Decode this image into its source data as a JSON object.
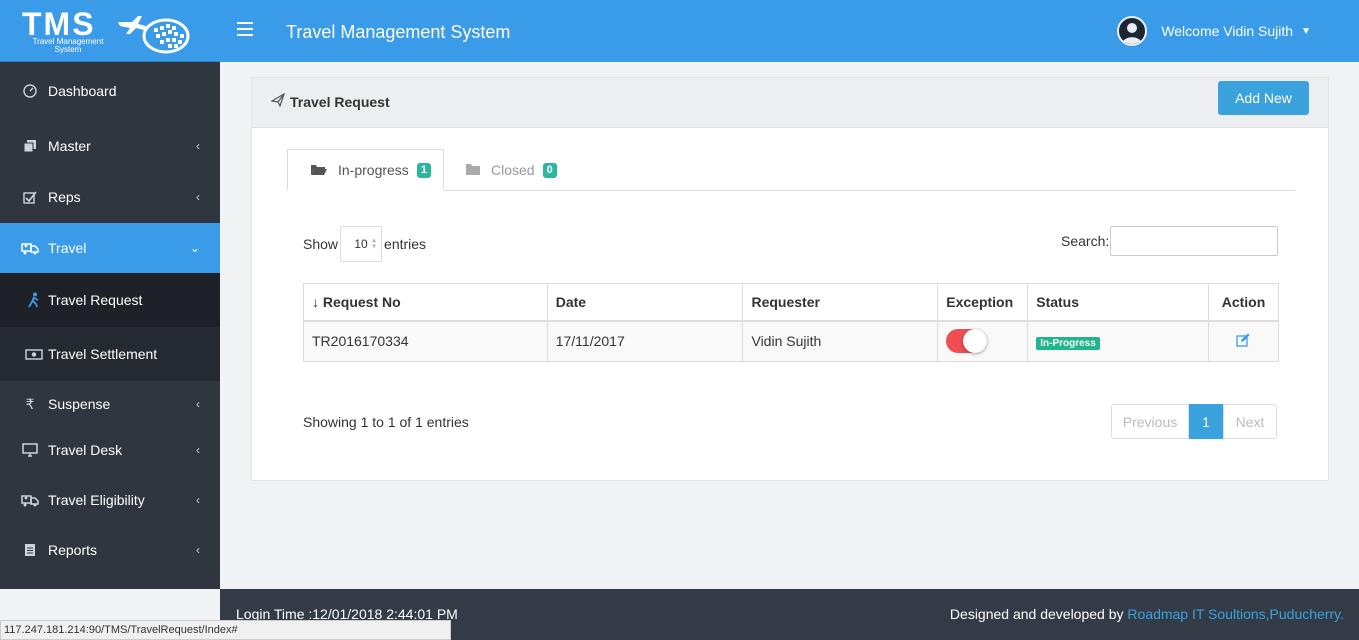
{
  "logo": {
    "text": "TMS",
    "subtext": "Travel Management System"
  },
  "header": {
    "title": "Travel Management System",
    "user_greeting": "Welcome Vidin Sujith"
  },
  "sidebar": {
    "items": [
      {
        "label": "Dashboard",
        "icon": "dashboard-icon"
      },
      {
        "label": "Master",
        "icon": "copy-icon"
      },
      {
        "label": "Reps",
        "icon": "check-square-icon"
      },
      {
        "label": "Travel",
        "icon": "travel-icon"
      },
      {
        "label": "Suspense",
        "icon": "rupee-icon"
      },
      {
        "label": "Travel Desk",
        "icon": "desktop-icon"
      },
      {
        "label": "Travel Eligibility",
        "icon": "travel-icon"
      },
      {
        "label": "Reports",
        "icon": "file-icon"
      }
    ],
    "travel_sub": [
      {
        "label": "Travel Request",
        "icon": "walking-icon"
      },
      {
        "label": "Travel Settlement",
        "icon": "money-icon"
      }
    ]
  },
  "card": {
    "title": "Travel Request",
    "add_label": "Add New"
  },
  "tabs": [
    {
      "label": "In-progress",
      "count": "1"
    },
    {
      "label": "Closed",
      "count": "0"
    }
  ],
  "table_controls": {
    "show_label": "Show",
    "page_size": "10",
    "entries_label": "entries",
    "search_label": "Search:"
  },
  "table": {
    "headers": [
      "↓ Request No",
      "Date",
      "Requester",
      "Exception",
      "Status",
      "Action"
    ],
    "rows": [
      {
        "request_no": "TR2016170334",
        "date": "17/11/2017",
        "requester": "Vidin Sujith",
        "exception": true,
        "status": "In-Progress"
      }
    ]
  },
  "pagination": {
    "info": "Showing 1 to 1 of 1 entries",
    "prev": "Previous",
    "page": "1",
    "next": "Next"
  },
  "footer": {
    "login_time": "Login Time :12/01/2018 2:44:01 PM",
    "credit_prefix": "Designed and developed by",
    "credit_link": "Roadmap IT Soultions,Puducherry."
  },
  "browser_status": "117.247.181.214:90/TMS/TravelRequest/Index#",
  "colors": {
    "primary": "#3a9be8",
    "sidebar": "#2f3640",
    "badge": "#2cb5a1",
    "toggle_on": "#f04e55"
  }
}
